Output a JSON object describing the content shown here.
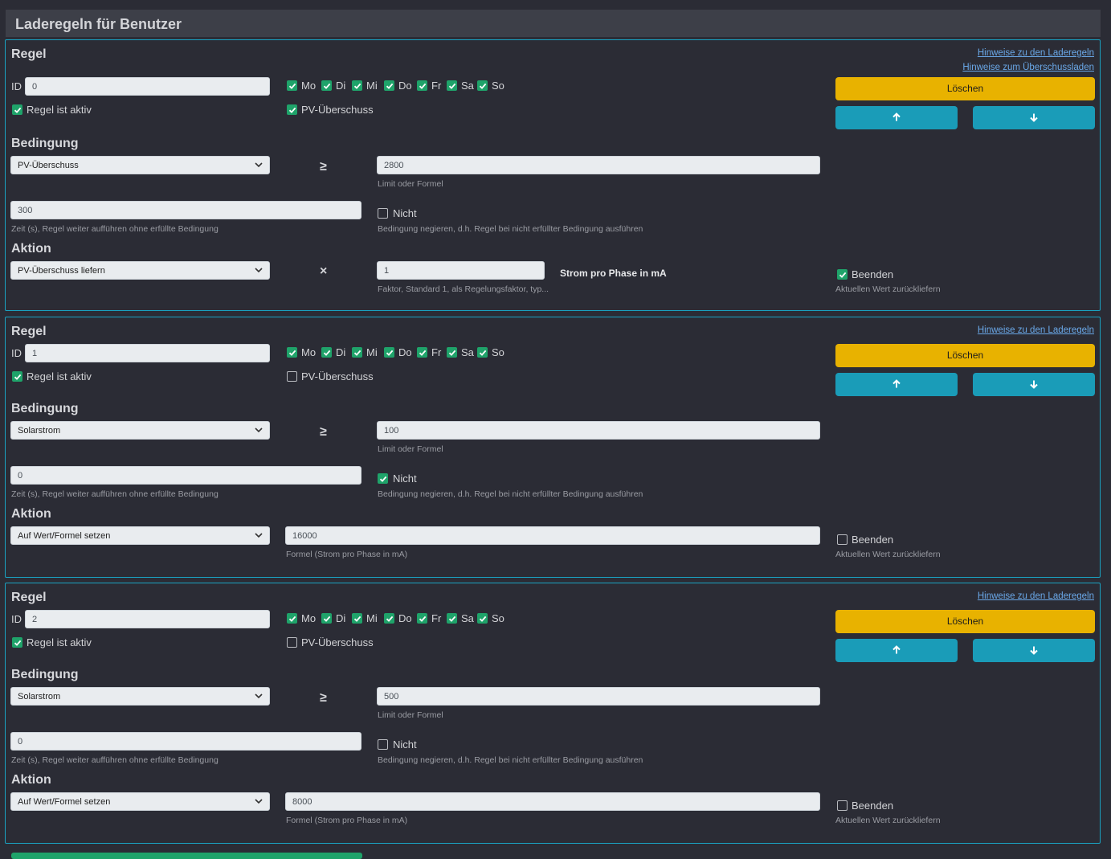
{
  "page": {
    "title": "Laderegeln für Benutzer"
  },
  "labels": {
    "rule_section": "Regel",
    "condition_section": "Bedingung",
    "action_section": "Aktion",
    "id": "ID",
    "active": "Regel ist aktiv",
    "pv": "PV-Überschuss",
    "delete": "Löschen",
    "hint_link_rules": "Hinweise zu den Laderegeln",
    "hint_link_surplus": "Hinweise zum Überschussladen",
    "ge": "≥",
    "times": "×",
    "limit_hint": "Limit oder Formel",
    "time_hint": "Zeit (s), Regel weiter aufführen ohne erfüllte Bedingung",
    "not": "Nicht",
    "not_hint": "Bedingung negieren, d.h. Regel bei nicht erfüllter Bedingung ausführen",
    "end": "Beenden",
    "end_hint": "Aktuellen Wert zurückliefern",
    "factor_hint": "Faktor, Standard 1, als Regelungsfaktor, typ...",
    "current_per_phase": "Strom pro Phase in mA",
    "formula_hint": "Formel (Strom pro Phase in mA)"
  },
  "days": [
    "Mo",
    "Di",
    "Mi",
    "Do",
    "Fr",
    "Sa",
    "So"
  ],
  "rules": [
    {
      "id": "0",
      "active": true,
      "pv_surplus": true,
      "days_checked": [
        true,
        true,
        true,
        true,
        true,
        true,
        true
      ],
      "condition": "PV-Überschuss",
      "limit": "2800",
      "time": "300",
      "negate": false,
      "action": "PV-Überschuss liefern",
      "factor": "1",
      "end": true
    },
    {
      "id": "1",
      "active": true,
      "pv_surplus": false,
      "days_checked": [
        true,
        true,
        true,
        true,
        true,
        true,
        true
      ],
      "condition": "Solarstrom",
      "limit": "100",
      "time": "0",
      "negate": true,
      "action": "Auf Wert/Formel setzen",
      "formula": "16000",
      "end": false
    },
    {
      "id": "2",
      "active": true,
      "pv_surplus": false,
      "days_checked": [
        true,
        true,
        true,
        true,
        true,
        true,
        true
      ],
      "condition": "Solarstrom",
      "limit": "500",
      "time": "0",
      "negate": false,
      "action": "Auf Wert/Formel setzen",
      "formula": "8000",
      "end": false
    }
  ]
}
